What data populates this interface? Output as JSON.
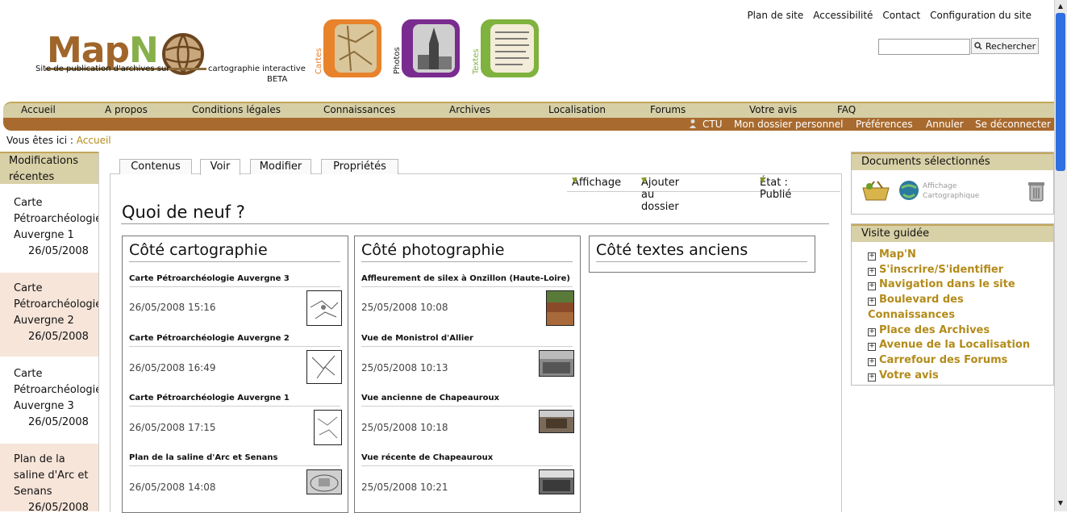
{
  "logo": {
    "word_map": "Map",
    "word_n": "N",
    "tagline_left": "Site de publication d'archives sur",
    "tagline_right": "cartographie interactive",
    "beta": "BETA"
  },
  "categories": [
    {
      "label": "Cartes",
      "color": "#e8822b"
    },
    {
      "label": "Photos",
      "color": "#7a2b8f"
    },
    {
      "label": "Textes",
      "color": "#7fb23e"
    }
  ],
  "top_links": [
    "Plan de site",
    "Accessibilité",
    "Contact",
    "Configuration du site"
  ],
  "search": {
    "placeholder": "",
    "button": "Rechercher"
  },
  "nav": [
    "Accueil",
    "A propos",
    "Conditions légales",
    "Connaissances",
    "Archives",
    "Localisation",
    "Forums",
    "Votre avis",
    "FAQ"
  ],
  "user_bar": {
    "user": "CTU",
    "links": [
      "Mon dossier personnel",
      "Préférences",
      "Annuler",
      "Se déconnecter"
    ]
  },
  "breadcrumb": {
    "prefix": "Vous êtes ici :",
    "current": "Accueil"
  },
  "recent": {
    "title": "Modifications récentes",
    "items": [
      {
        "lines": [
          "Carte",
          "Pétroarchéologie",
          "Auvergne 1"
        ],
        "date": "26/05/2008"
      },
      {
        "lines": [
          "Carte",
          "Pétroarchéologie",
          "Auvergne 2"
        ],
        "date": "26/05/2008"
      },
      {
        "lines": [
          "Carte",
          "Pétroarchéologie",
          "Auvergne 3"
        ],
        "date": "26/05/2008"
      },
      {
        "lines": [
          "Plan de la",
          "saline d'Arc et",
          "Senans"
        ],
        "date": "26/05/2008"
      }
    ]
  },
  "tabs": [
    "Contenus",
    "Voir",
    "Modifier",
    "Propriétés"
  ],
  "actions": [
    "Affichage",
    "Ajouter au dossier",
    "État : Publié"
  ],
  "page_title": "Quoi de neuf ?",
  "columns": [
    {
      "title": "Côté cartographie",
      "entries": [
        {
          "title": "Carte Pétroarchéologie Auvergne 3",
          "date": "26/05/2008 15:16"
        },
        {
          "title": "Carte Pétroarchéologie Auvergne 2",
          "date": "26/05/2008 16:49"
        },
        {
          "title": "Carte Pétroarchéologie Auvergne 1",
          "date": "26/05/2008 17:15"
        },
        {
          "title": "Plan de la saline d'Arc et Senans",
          "date": "26/05/2008 14:08"
        }
      ]
    },
    {
      "title": "Côté photographie",
      "entries": [
        {
          "title": "Affleurement de silex à Onzillon (Haute-Loire)",
          "date": "25/05/2008 10:08"
        },
        {
          "title": "Vue de Monistrol d'Allier",
          "date": "25/05/2008 10:13"
        },
        {
          "title": "Vue ancienne de Chapeauroux",
          "date": "25/05/2008 10:18"
        },
        {
          "title": "Vue récente de Chapeauroux",
          "date": "25/05/2008 10:21"
        }
      ]
    },
    {
      "title": "Côté textes anciens",
      "entries": []
    }
  ],
  "selected_docs": {
    "title": "Documents sélectionnés",
    "display_label": "Affichage",
    "display_sub": "Cartographique"
  },
  "guided_tour": {
    "title": "Visite guidée",
    "items": [
      "Map'N",
      "S'inscrire/S'identifier",
      "Navigation dans le site",
      "Boulevard des",
      "Connaissances",
      "Place des Archives",
      "Avenue de la Localisation",
      "Carrefour des Forums",
      "Votre avis"
    ]
  }
}
